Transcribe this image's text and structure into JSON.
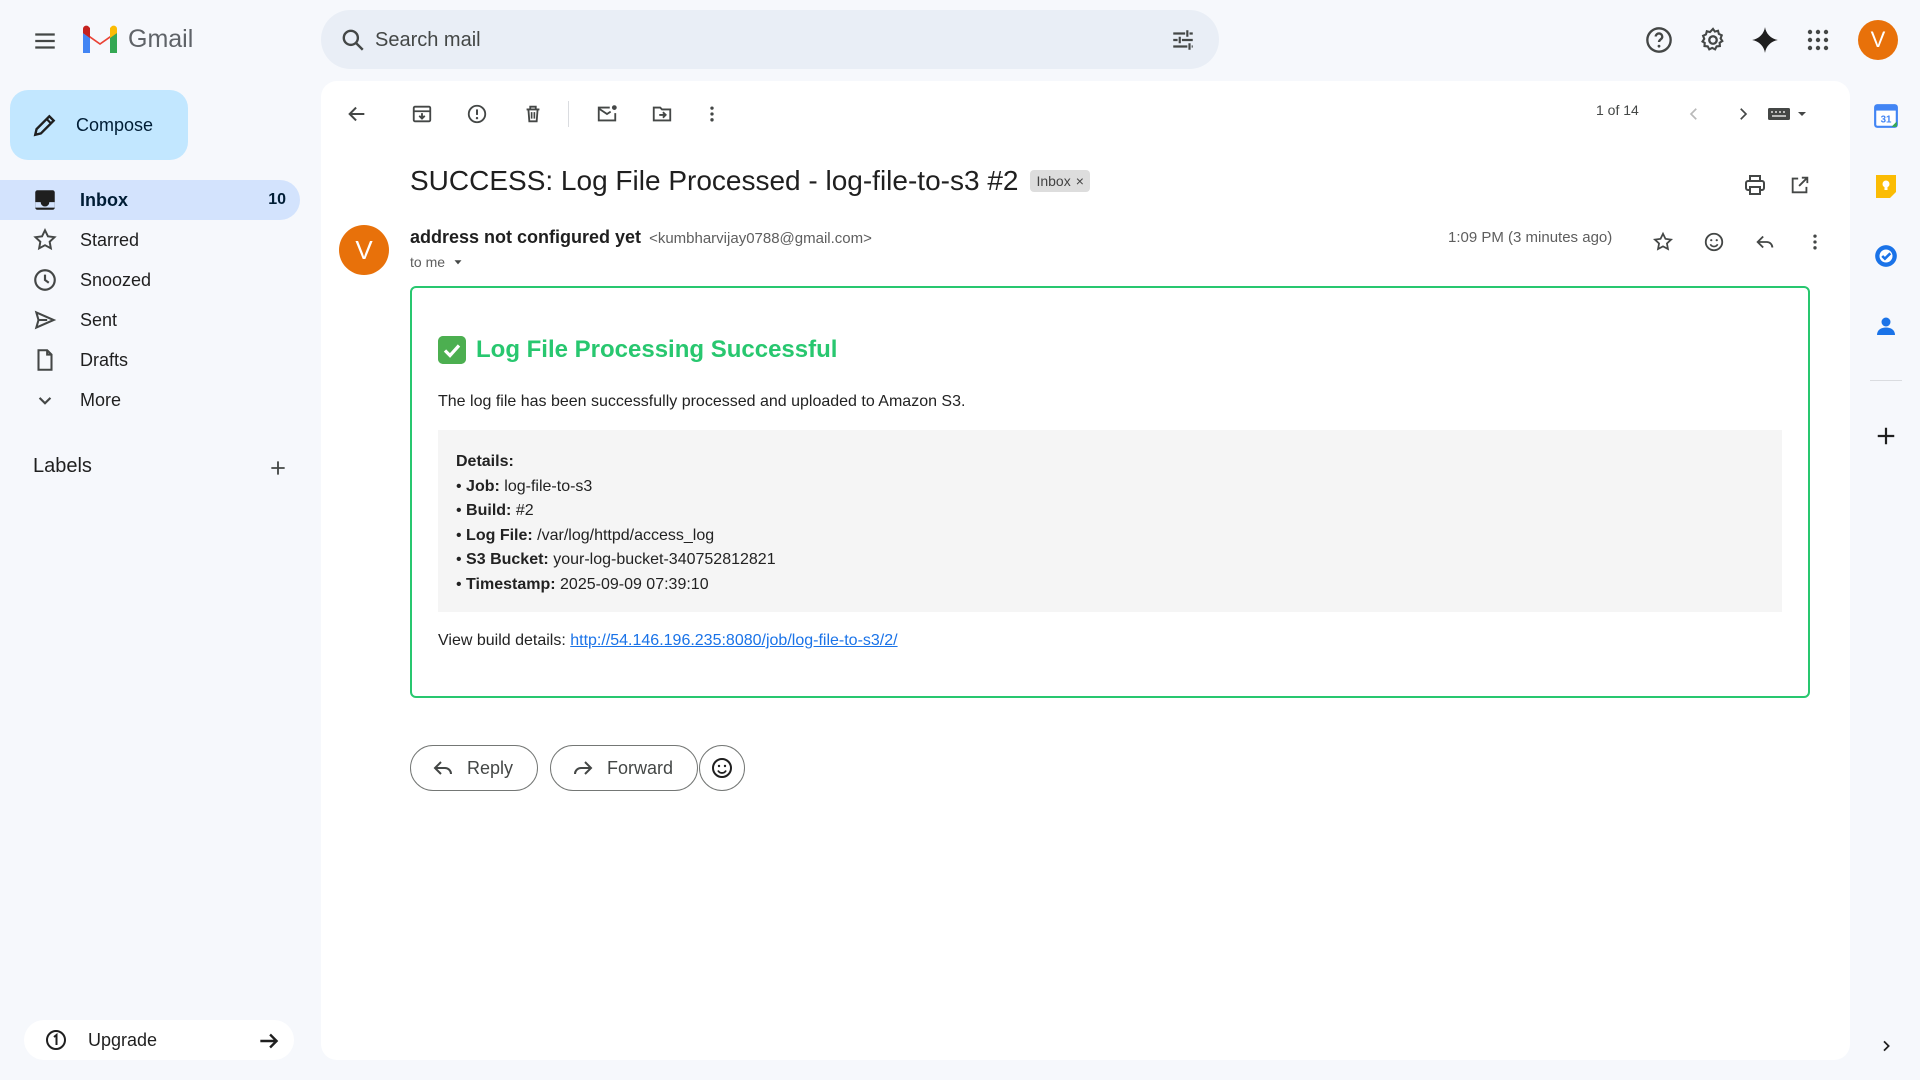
{
  "app": {
    "name": "Gmail"
  },
  "search": {
    "placeholder": "Search mail"
  },
  "user": {
    "initial": "V"
  },
  "compose": {
    "label": "Compose"
  },
  "sidebar": {
    "items": [
      {
        "label": "Inbox",
        "count": "10",
        "icon": "inbox-icon"
      },
      {
        "label": "Starred",
        "icon": "star-icon"
      },
      {
        "label": "Snoozed",
        "icon": "clock-icon"
      },
      {
        "label": "Sent",
        "icon": "send-icon"
      },
      {
        "label": "Drafts",
        "icon": "draft-icon"
      },
      {
        "label": "More",
        "icon": "chevron-down-icon"
      }
    ],
    "labels_heading": "Labels",
    "upgrade_label": "Upgrade"
  },
  "toolbar": {
    "pager": "1 of 14"
  },
  "message": {
    "subject": "SUCCESS: Log File Processed - log-file-to-s3 #2",
    "label_chip": "Inbox",
    "chip_close": "×",
    "sender_name": "address not configured yet",
    "sender_email": "<kumbharvijay0788@gmail.com>",
    "recipient": "to me",
    "time": "1:09 PM (3 minutes ago)"
  },
  "email_body": {
    "title": "Log File Processing Successful",
    "description": "The log file has been successfully processed and uploaded to Amazon S3.",
    "details_heading": "Details:",
    "details": [
      {
        "key": "Job:",
        "value": "log-file-to-s3"
      },
      {
        "key": "Build:",
        "value": "#2"
      },
      {
        "key": "Log File:",
        "value": "/var/log/httpd/access_log"
      },
      {
        "key": "S3 Bucket:",
        "value": "your-log-bucket-340752812821"
      },
      {
        "key": "Timestamp:",
        "value": "2025-09-09 07:39:10"
      }
    ],
    "link_prefix": "View build details: ",
    "link_url": "http://54.146.196.235:8080/job/log-file-to-s3/2/"
  },
  "actions": {
    "reply_label": "Reply",
    "forward_label": "Forward"
  },
  "colors": {
    "accent": "#0b57d0",
    "success": "#28c76f",
    "avatar": "#e8710a",
    "compose_bg": "#c2e7ff",
    "active_nav": "#d3e3fd"
  }
}
